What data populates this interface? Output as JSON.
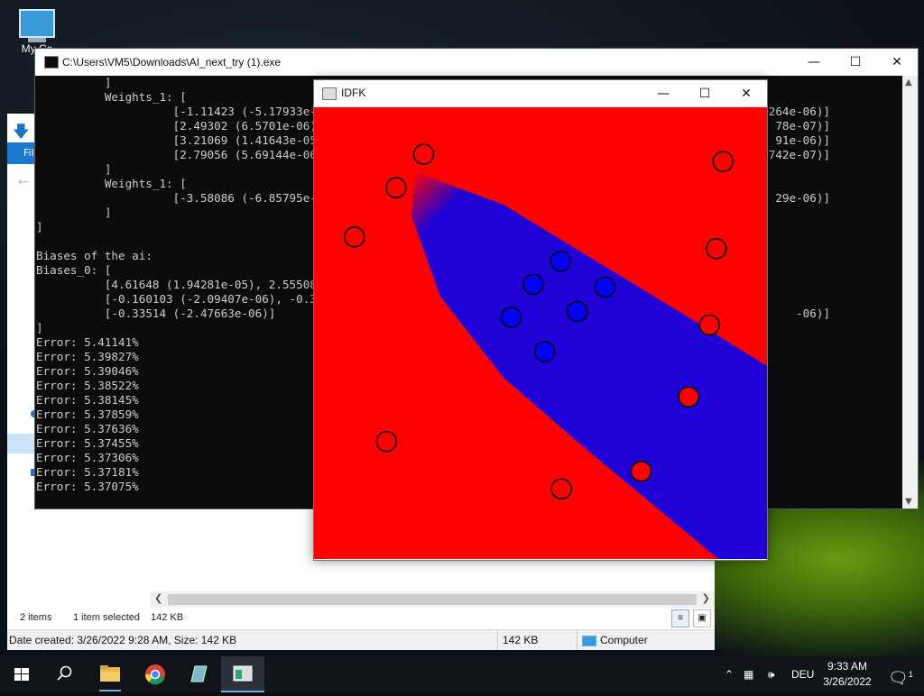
{
  "desktop": {
    "icon_label": "My Co"
  },
  "explorer": {
    "file_tab": "Fil",
    "status_items": "2 items",
    "status_selected": "1 item selected",
    "status_size": "142 KB",
    "details_left": "Date created: 3/26/2022 9:28 AM, Size: 142 KB",
    "details_size": "142 KB",
    "details_location": "Computer"
  },
  "console": {
    "title": "C:\\Users\\VM5\\Downloads\\AI_next_try (1).exe",
    "lines": [
      "          ]",
      "          Weights_1: [",
      "                    [-1.11423 (-5.17933e-06",
      "                    [2.49302 (6.5701e-06),",
      "                    [3.21069 (1.41643e-05),",
      "                    [2.79056 (5.69144e-06),",
      "          ]",
      "          Weights_1: [",
      "                    [-3.58086 (-6.85795e-06",
      "          ]",
      "]",
      "",
      "Biases of the ai:",
      "Biases_0: [",
      "          [4.61648 (1.94281e-05), 2.55508",
      "          [-0.160103 (-2.09407e-06), -0.3",
      "          [-0.33514 (-2.47663e-06)]",
      "]",
      "Error: 5.41141%",
      "Error: 5.39827%",
      "Error: 5.39046%",
      "Error: 5.38522%",
      "Error: 5.38145%",
      "Error: 5.37859%",
      "Error: 5.37636%",
      "Error: 5.37455%",
      "Error: 5.37306%",
      "Error: 5.37181%",
      "Error: 5.37075%"
    ],
    "right_fragments": [
      "06264e-06)]",
      "78e-07)]",
      "91e-06)]",
      "82742e-07)]",
      "29e-06)]",
      "-06)]"
    ]
  },
  "idfk": {
    "title": "IDFK",
    "colors": {
      "red": "#ff0000",
      "blue": "#1f00d6",
      "point_blue": "#0000ff",
      "outline": "#000000"
    },
    "red_points": [
      [
        0.242,
        0.104
      ],
      [
        0.903,
        0.12
      ],
      [
        0.181,
        0.178
      ],
      [
        0.089,
        0.287
      ],
      [
        0.888,
        0.313
      ],
      [
        0.873,
        0.482
      ],
      [
        0.827,
        0.641
      ],
      [
        0.16,
        0.74
      ],
      [
        0.722,
        0.806
      ],
      [
        0.546,
        0.845
      ]
    ],
    "blue_points": [
      [
        0.544,
        0.341
      ],
      [
        0.484,
        0.392
      ],
      [
        0.642,
        0.398
      ],
      [
        0.581,
        0.452
      ],
      [
        0.435,
        0.465
      ],
      [
        0.509,
        0.541
      ]
    ]
  },
  "taskbar": {
    "lang": "DEU",
    "time": "9:33 AM",
    "date": "3/26/2022",
    "notif_count": "1"
  }
}
